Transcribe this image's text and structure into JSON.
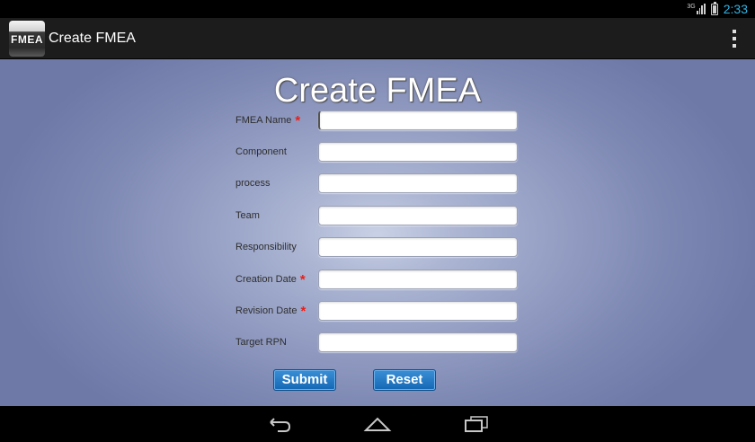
{
  "status_bar": {
    "network": "3G",
    "time": "2:33"
  },
  "action_bar": {
    "logo_text": "FMEA",
    "title": "Create FMEA",
    "overflow_icon": "overflow-menu-icon"
  },
  "form": {
    "heading": "Create FMEA",
    "fields": [
      {
        "label": "FMEA Name",
        "required": "*",
        "value": ""
      },
      {
        "label": "Component",
        "required": "",
        "value": ""
      },
      {
        "label": "process",
        "required": "",
        "value": ""
      },
      {
        "label": "Team",
        "required": "",
        "value": ""
      },
      {
        "label": "Responsibility",
        "required": "",
        "value": ""
      },
      {
        "label": "Creation Date",
        "required": "*",
        "value": ""
      },
      {
        "label": "Revision Date",
        "required": "*",
        "value": ""
      },
      {
        "label": "Target RPN",
        "required": "",
        "value": ""
      }
    ],
    "submit_label": "Submit",
    "reset_label": "Reset"
  },
  "nav_bar": {
    "icons": [
      "back-icon",
      "home-icon",
      "recents-icon"
    ]
  },
  "colors": {
    "accent": "#33b5e5",
    "button": "#1a73c2",
    "required": "#e8201a"
  }
}
